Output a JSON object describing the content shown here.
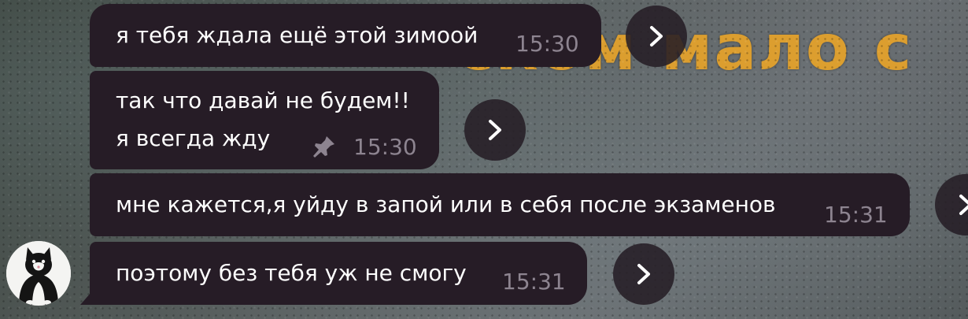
{
  "background": {
    "overlay_text": "ском мало с",
    "accent_color": "#e6a32a"
  },
  "messages": [
    {
      "text": "я тебя ждала ещё этой зимоой",
      "time": "15:30"
    },
    {
      "text": "так что давай не будем!!\nя всегда жду",
      "time": "15:30",
      "pinned": true,
      "pin_icon": "pin-icon"
    },
    {
      "text": "мне кажется,я уйду в запой или в себя после экзаменов",
      "time": "15:31"
    },
    {
      "text": "поэтому без тебя уж не смогу",
      "time": "15:31"
    }
  ],
  "share_icon": "chevron-right-icon",
  "avatar_icon": "cat-avatar",
  "bubble_color": "#261c26"
}
